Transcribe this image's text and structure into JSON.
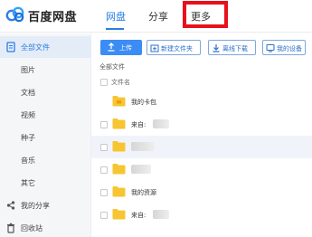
{
  "header": {
    "brand": "百度网盘",
    "tabs": [
      {
        "label": "网盘"
      },
      {
        "label": "分享"
      },
      {
        "label": "更多"
      }
    ]
  },
  "sidebar": {
    "items": [
      {
        "label": "全部文件"
      },
      {
        "label": "图片"
      },
      {
        "label": "文档"
      },
      {
        "label": "视频"
      },
      {
        "label": "种子"
      },
      {
        "label": "音乐"
      },
      {
        "label": "其它"
      },
      {
        "label": "我的分享"
      },
      {
        "label": "回收站"
      }
    ]
  },
  "toolbar": {
    "upload": "上传",
    "new_folder": "新建文件夹",
    "offline_download": "离线下载",
    "my_devices": "我的设备"
  },
  "breadcrumb": "全部文件",
  "list": {
    "header": "文件名",
    "rows": [
      {
        "name": "我的卡包"
      },
      {
        "name": "来自:"
      },
      {
        "name": ""
      },
      {
        "name": ""
      },
      {
        "name": "我的资源"
      },
      {
        "name": "来自:"
      }
    ]
  },
  "colors": {
    "accent": "#2a7de1",
    "primary_button": "#3b8cf5",
    "folder": "#f7c531",
    "highlight_box": "#e8101b",
    "sidebar_bg": "#f5f6f8"
  }
}
